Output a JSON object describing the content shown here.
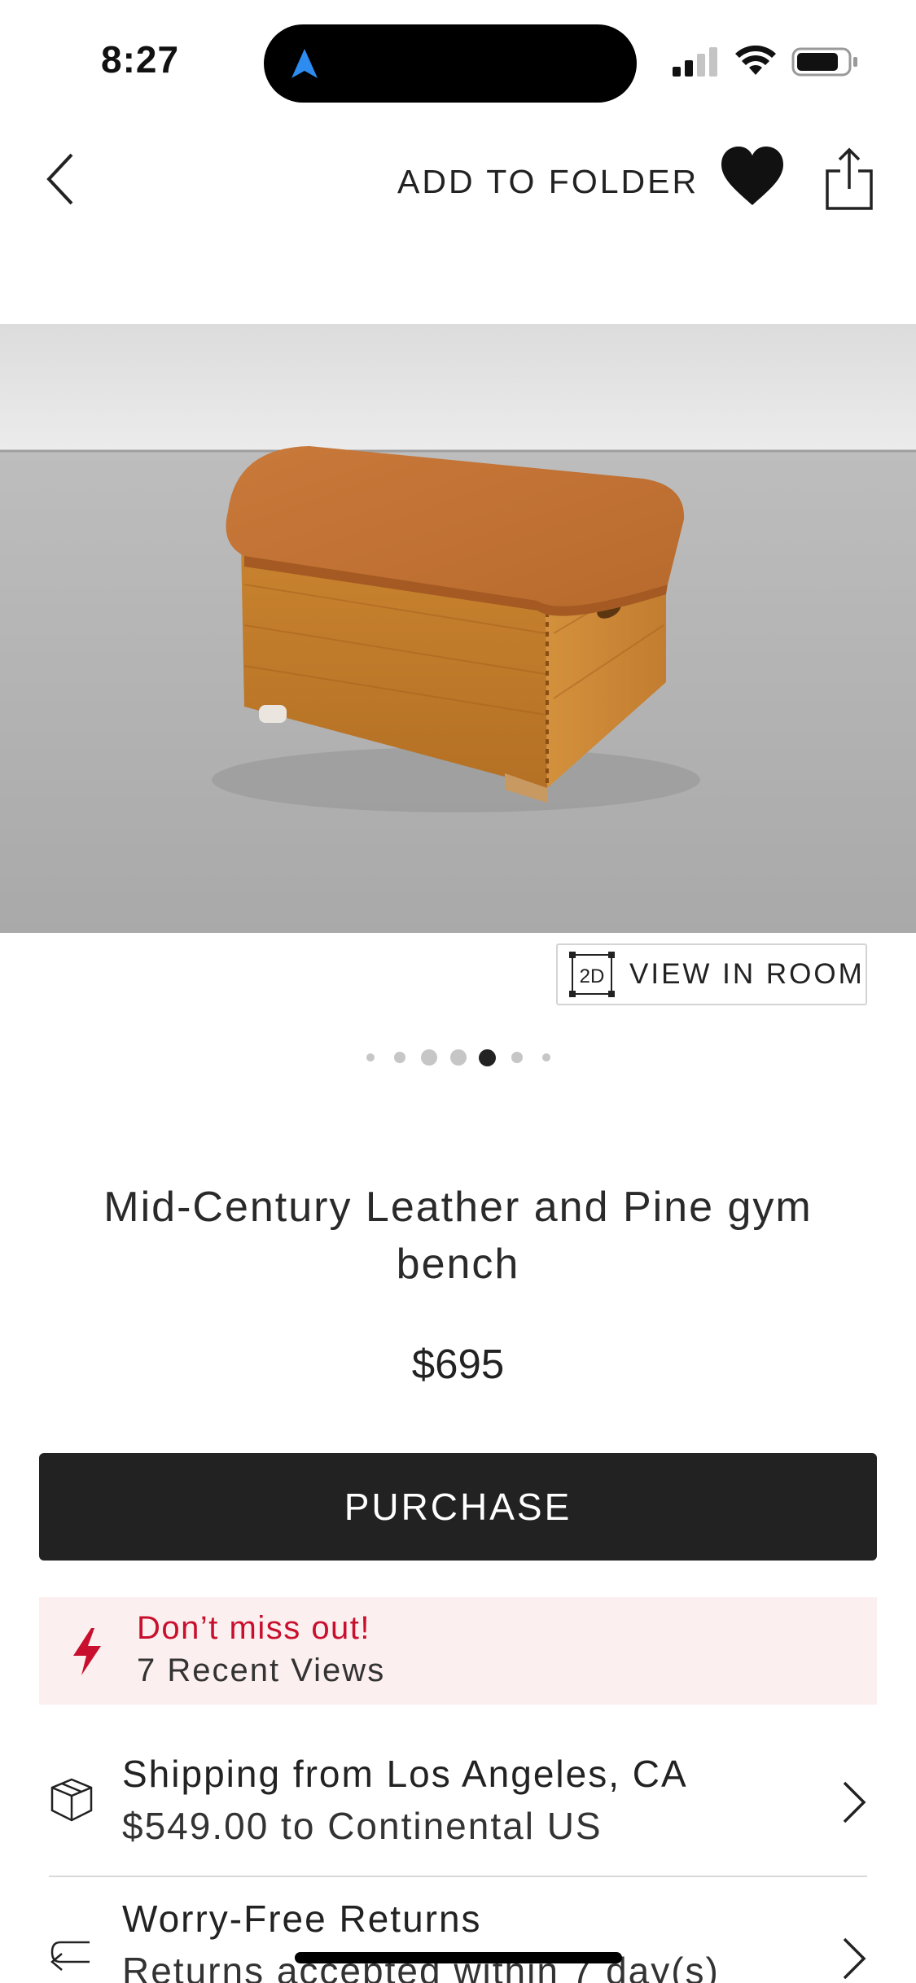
{
  "status_bar": {
    "time": "8:27"
  },
  "nav": {
    "add_to_folder": "ADD TO FOLDER"
  },
  "gallery": {
    "view_in_room": "VIEW IN ROOM",
    "view_in_room_badge": "2D",
    "dot_count": 7,
    "active_index": 4
  },
  "product": {
    "title": "Mid-Century Leather and Pine gym bench",
    "price": "$695"
  },
  "purchase_label": "PURCHASE",
  "alert": {
    "headline": "Don’t miss out!",
    "subtext": "7 Recent Views",
    "color": "#c8102e"
  },
  "shipping": {
    "title": "Shipping from Los Angeles, CA",
    "subtitle": "$549.00 to Continental US"
  },
  "returns": {
    "title": "Worry-Free Returns",
    "subtitle": "Returns accepted within 7 day(s)"
  },
  "icons": {
    "back": "chevron-left-icon",
    "favorite": "heart-icon",
    "share": "share-icon",
    "alert": "lightning-bolt-icon",
    "shipping": "package-box-icon",
    "returns": "return-arrow-icon",
    "row": "chevron-right-icon"
  }
}
